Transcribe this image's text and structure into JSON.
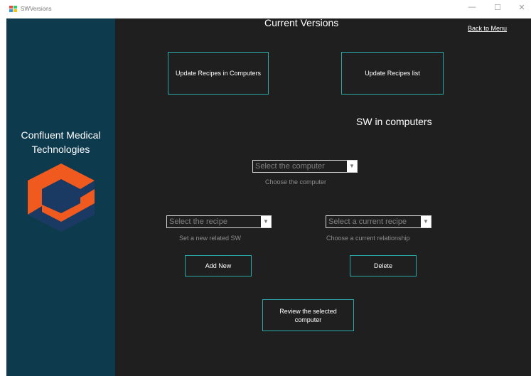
{
  "window": {
    "title": "SWVersions",
    "icon": "windows-forms-app-icon",
    "controls": {
      "minimize": "—",
      "maximize": "☐",
      "close": "✕"
    }
  },
  "sidebar": {
    "company_line1": "Confluent Medical",
    "company_line2": "Technologies",
    "logo": "confluent-hexagon-logo",
    "colors": {
      "background": "#0e3a4e",
      "logo_orange": "#f05a1e",
      "logo_navy": "#1b3a63"
    }
  },
  "main": {
    "title": "Current Versions",
    "back_link": "Back to Menu",
    "section_title": "SW in computers",
    "buttons": {
      "update_computers": "Update Recipes in Computers",
      "update_list": "Update Recipes list",
      "add_new": "Add New",
      "delete": "Delete",
      "review": "Review the selected computer"
    },
    "computer_select": {
      "value": "Select the computer",
      "hint": "Choose the computer"
    },
    "recipe_select": {
      "value": "Select the recipe",
      "hint": "Set a new related SW"
    },
    "current_recipe_select": {
      "value": "Select a current recipe",
      "hint": "Choose a current relationship"
    },
    "colors": {
      "background": "#1f1f1f",
      "button_border": "#2aa8a8"
    }
  }
}
